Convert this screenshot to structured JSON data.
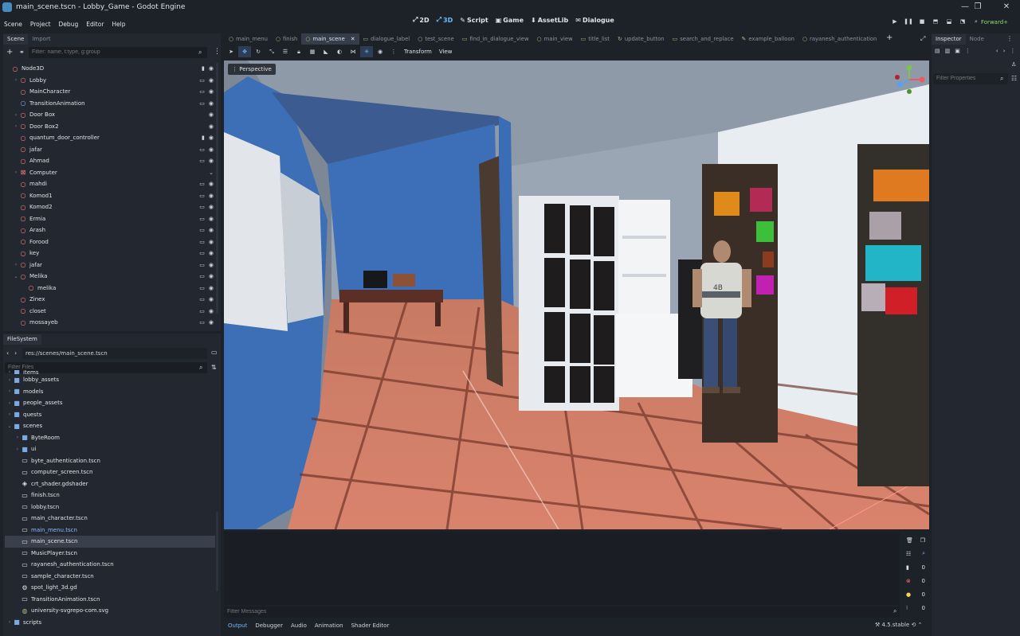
{
  "window": {
    "title": "main_scene.tscn - Lobby_Game - Godot Engine",
    "controls": [
      "—",
      "❐",
      "✕"
    ]
  },
  "menu": [
    "Scene",
    "Project",
    "Debug",
    "Editor",
    "Help"
  ],
  "modes": [
    {
      "icon": "transform-2d-icon",
      "label": "2D",
      "active": false
    },
    {
      "icon": "transform-3d-icon",
      "label": "3D",
      "active": true
    },
    {
      "icon": "script-icon",
      "label": "Script",
      "active": false
    },
    {
      "icon": "game-icon",
      "label": "Game",
      "active": false
    },
    {
      "icon": "assetlib-icon",
      "label": "AssetLib",
      "active": false
    },
    {
      "icon": "dialogue-icon",
      "label": "Dialogue",
      "active": false
    }
  ],
  "renderer": "Forward+",
  "scene_panel": {
    "tabs": [
      "Scene",
      "Import"
    ],
    "filter_placeholder": "Filter: name, t:type, g:group",
    "nodes": [
      {
        "label": "Node3D",
        "depth": 0,
        "arrow": "",
        "icons": [
          "script",
          "eye"
        ],
        "selected": false
      },
      {
        "label": "Lobby",
        "depth": 1,
        "arrow": "›",
        "icons": [
          "film",
          "eye"
        ]
      },
      {
        "label": "MainCharacter",
        "depth": 1,
        "arrow": "",
        "icons": [
          "film",
          "eye"
        ]
      },
      {
        "label": "TransitionAnimation",
        "depth": 1,
        "arrow": "",
        "icons": [
          "film",
          "eye"
        ]
      },
      {
        "label": "Door Box",
        "depth": 1,
        "arrow": "›",
        "icons": [
          "eye"
        ]
      },
      {
        "label": "Door Box2",
        "depth": 1,
        "arrow": "›",
        "icons": [
          "eye"
        ]
      },
      {
        "label": "quantum_door_controller",
        "depth": 1,
        "arrow": "",
        "icons": [
          "script",
          "eye"
        ]
      },
      {
        "label": "jafar",
        "depth": 1,
        "arrow": "",
        "icons": [
          "film",
          "eye"
        ]
      },
      {
        "label": "Ahmad",
        "depth": 1,
        "arrow": "",
        "icons": [
          "film",
          "eye"
        ]
      },
      {
        "label": "Computer",
        "depth": 1,
        "arrow": "›",
        "icons": [
          "fold"
        ]
      },
      {
        "label": "mahdi",
        "depth": 1,
        "arrow": "",
        "icons": [
          "film",
          "eye"
        ]
      },
      {
        "label": "Komod1",
        "depth": 1,
        "arrow": "",
        "icons": [
          "film",
          "eye"
        ]
      },
      {
        "label": "Komod2",
        "depth": 1,
        "arrow": "",
        "icons": [
          "film",
          "eye"
        ]
      },
      {
        "label": "Ermia",
        "depth": 1,
        "arrow": "",
        "icons": [
          "film",
          "eye"
        ]
      },
      {
        "label": "Arash",
        "depth": 1,
        "arrow": "",
        "icons": [
          "film",
          "eye"
        ]
      },
      {
        "label": "Forood",
        "depth": 1,
        "arrow": "",
        "icons": [
          "film",
          "eye"
        ]
      },
      {
        "label": "key",
        "depth": 1,
        "arrow": "",
        "icons": [
          "film",
          "eye"
        ]
      },
      {
        "label": "jafar",
        "depth": 1,
        "arrow": "›",
        "icons": [
          "film",
          "eye"
        ]
      },
      {
        "label": "Melika",
        "depth": 1,
        "arrow": "⌄",
        "icons": [
          "film",
          "eye"
        ]
      },
      {
        "label": "melika",
        "depth": 2,
        "arrow": "",
        "icons": [
          "film",
          "eye"
        ]
      },
      {
        "label": "Zinex",
        "depth": 1,
        "arrow": "",
        "icons": [
          "film",
          "eye"
        ]
      },
      {
        "label": "closet",
        "depth": 1,
        "arrow": "",
        "icons": [
          "film",
          "eye"
        ]
      },
      {
        "label": "mossayeb",
        "depth": 1,
        "arrow": "",
        "icons": [
          "film",
          "eye"
        ]
      }
    ]
  },
  "filesystem": {
    "tab": "FileSystem",
    "path": "res://scenes/main_scene.tscn",
    "filter_placeholder": "Filter Files",
    "items": [
      {
        "label": "items",
        "depth": 1,
        "type": "folder",
        "arrow": "›"
      },
      {
        "label": "lobby_assets",
        "depth": 1,
        "type": "folder",
        "arrow": "›"
      },
      {
        "label": "models",
        "depth": 1,
        "type": "folder",
        "arrow": "›"
      },
      {
        "label": "people_assets",
        "depth": 1,
        "type": "folder",
        "arrow": "›"
      },
      {
        "label": "quests",
        "depth": 1,
        "type": "folder",
        "arrow": "›"
      },
      {
        "label": "scenes",
        "depth": 1,
        "type": "folder",
        "arrow": "⌄"
      },
      {
        "label": "ByteRoom",
        "depth": 2,
        "type": "folder",
        "arrow": "›"
      },
      {
        "label": "ui",
        "depth": 2,
        "type": "folder",
        "arrow": "›"
      },
      {
        "label": "byte_authentication.tscn",
        "depth": 2,
        "type": "scene"
      },
      {
        "label": "computer_screen.tscn",
        "depth": 2,
        "type": "scene"
      },
      {
        "label": "crt_shader.gdshader",
        "depth": 2,
        "type": "shader"
      },
      {
        "label": "finish.tscn",
        "depth": 2,
        "type": "scene"
      },
      {
        "label": "lobby.tscn",
        "depth": 2,
        "type": "scene"
      },
      {
        "label": "main_character.tscn",
        "depth": 2,
        "type": "scene"
      },
      {
        "label": "main_menu.tscn",
        "depth": 2,
        "type": "scene",
        "open": true
      },
      {
        "label": "main_scene.tscn",
        "depth": 2,
        "type": "scene",
        "selected": true
      },
      {
        "label": "MusicPlayer.tscn",
        "depth": 2,
        "type": "scene"
      },
      {
        "label": "rayanesh_authentication.tscn",
        "depth": 2,
        "type": "scene"
      },
      {
        "label": "sample_character.tscn",
        "depth": 2,
        "type": "scene"
      },
      {
        "label": "spot_light_3d.gd",
        "depth": 2,
        "type": "script"
      },
      {
        "label": "TransitionAnimation.tscn",
        "depth": 2,
        "type": "scene"
      },
      {
        "label": "university-svgrepo-com.svg",
        "depth": 2,
        "type": "image"
      },
      {
        "label": "scripts",
        "depth": 1,
        "type": "folder",
        "arrow": "›"
      }
    ]
  },
  "editor_tabs": [
    {
      "label": "main_menu",
      "icon": "○"
    },
    {
      "label": "finish",
      "icon": "○"
    },
    {
      "label": "main_scene",
      "icon": "○",
      "active": true
    },
    {
      "label": "dialogue_label",
      "icon": "▭"
    },
    {
      "label": "test_scene",
      "icon": "○"
    },
    {
      "label": "find_in_dialogue_view",
      "icon": "▭"
    },
    {
      "label": "main_view",
      "icon": "○"
    },
    {
      "label": "title_list",
      "icon": "▭"
    },
    {
      "label": "update_button",
      "icon": "↻"
    },
    {
      "label": "search_and_replace",
      "icon": "▭"
    },
    {
      "label": "example_balloon",
      "icon": "✎"
    },
    {
      "label": "rayanesh_authentication",
      "icon": "○"
    }
  ],
  "viewport_toolbar": {
    "transform": "Transform",
    "view": "View"
  },
  "viewport": {
    "perspective_label": "Perspective",
    "shirt_text": "4B"
  },
  "output": {
    "filter_placeholder": "Filter Messages",
    "counts": {
      "messages": "0",
      "errors": "0",
      "warnings": "0",
      "info": "0"
    },
    "tabs": [
      "Output",
      "Debugger",
      "Audio",
      "Animation",
      "Shader Editor"
    ],
    "version": "4.5.stable"
  },
  "inspector": {
    "tabs": [
      "Inspector",
      "Node"
    ],
    "filter_placeholder": "Filter Properties"
  },
  "colors": {
    "bg": "#1d2229",
    "panel": "#232830",
    "accent": "#70bafa",
    "node_icon": "#fc7f7f",
    "folder": "#7ea8e0",
    "renderer": "#8fdc6c"
  }
}
